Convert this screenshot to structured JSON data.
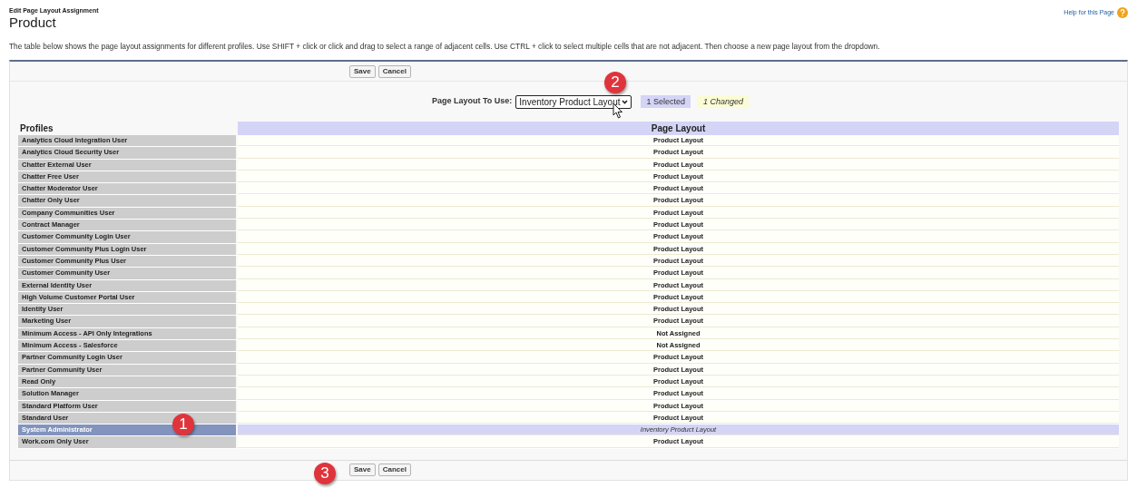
{
  "breadcrumb": "Edit Page Layout Assignment",
  "title": "Product",
  "help_link": "Help for this Page",
  "description": "The table below shows the page layout assignments for different profiles. Use SHIFT + click or click and drag to select a range of adjacent cells. Use CTRL + click to select multiple cells that are not adjacent. Then choose a new page layout from the dropdown.",
  "top_buttons": [
    "Save",
    "Cancel"
  ],
  "layout_picker": {
    "label": "Page Layout To Use:",
    "value": "Inventory Product Layout",
    "selected_count": "1 Selected",
    "changed_count": "1 Changed"
  },
  "table": {
    "columns": [
      "Profiles",
      "Page Layout"
    ],
    "rows": [
      {
        "profile": "Analytics Cloud Integration User",
        "layout": "Product Layout",
        "selected": false,
        "changed": false
      },
      {
        "profile": "Analytics Cloud Security User",
        "layout": "Product Layout",
        "selected": false,
        "changed": false
      },
      {
        "profile": "Chatter External User",
        "layout": "Product Layout",
        "selected": false,
        "changed": false
      },
      {
        "profile": "Chatter Free User",
        "layout": "Product Layout",
        "selected": false,
        "changed": false
      },
      {
        "profile": "Chatter Moderator User",
        "layout": "Product Layout",
        "selected": false,
        "changed": false
      },
      {
        "profile": "Chatter Only User",
        "layout": "Product Layout",
        "selected": false,
        "changed": false
      },
      {
        "profile": "Company Communities User",
        "layout": "Product Layout",
        "selected": false,
        "changed": false
      },
      {
        "profile": "Contract Manager",
        "layout": "Product Layout",
        "selected": false,
        "changed": false
      },
      {
        "profile": "Customer Community Login User",
        "layout": "Product Layout",
        "selected": false,
        "changed": false
      },
      {
        "profile": "Customer Community Plus Login User",
        "layout": "Product Layout",
        "selected": false,
        "changed": false
      },
      {
        "profile": "Customer Community Plus User",
        "layout": "Product Layout",
        "selected": false,
        "changed": false
      },
      {
        "profile": "Customer Community User",
        "layout": "Product Layout",
        "selected": false,
        "changed": false
      },
      {
        "profile": "External Identity User",
        "layout": "Product Layout",
        "selected": false,
        "changed": false
      },
      {
        "profile": "High Volume Customer Portal User",
        "layout": "Product Layout",
        "selected": false,
        "changed": false
      },
      {
        "profile": "Identity User",
        "layout": "Product Layout",
        "selected": false,
        "changed": false
      },
      {
        "profile": "Marketing User",
        "layout": "Product Layout",
        "selected": false,
        "changed": false
      },
      {
        "profile": "Minimum Access - API Only Integrations",
        "layout": "Not Assigned",
        "selected": false,
        "changed": false
      },
      {
        "profile": "Minimum Access - Salesforce",
        "layout": "Not Assigned",
        "selected": false,
        "changed": false
      },
      {
        "profile": "Partner Community Login User",
        "layout": "Product Layout",
        "selected": false,
        "changed": false
      },
      {
        "profile": "Partner Community User",
        "layout": "Product Layout",
        "selected": false,
        "changed": false
      },
      {
        "profile": "Read Only",
        "layout": "Product Layout",
        "selected": false,
        "changed": false
      },
      {
        "profile": "Solution Manager",
        "layout": "Product Layout",
        "selected": false,
        "changed": false
      },
      {
        "profile": "Standard Platform User",
        "layout": "Product Layout",
        "selected": false,
        "changed": false
      },
      {
        "profile": "Standard User",
        "layout": "Product Layout",
        "selected": false,
        "changed": false
      },
      {
        "profile": "System Administrator",
        "layout": "Inventory Product Layout",
        "selected": true,
        "changed": true
      },
      {
        "profile": "Work.com Only User",
        "layout": "Product Layout",
        "selected": false,
        "changed": false
      }
    ]
  },
  "bottom_buttons": [
    "Save",
    "Cancel"
  ],
  "callouts": [
    "1",
    "2",
    "3"
  ]
}
